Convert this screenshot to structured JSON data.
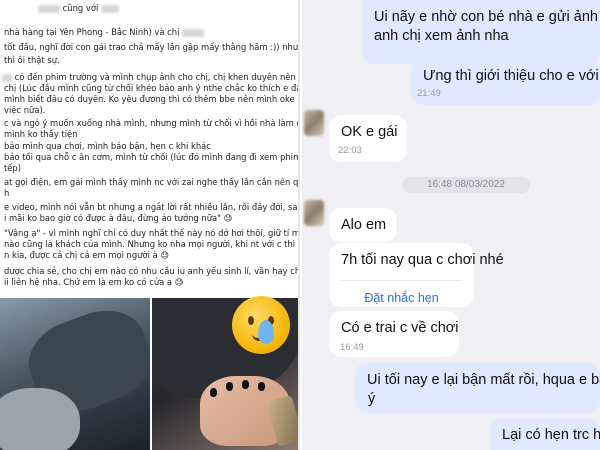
{
  "post": {
    "lines": [
      "cũng với",
      "nhà hàng tại Yên Phong - Bắc Ninh) và chị",
      "tốt đầu, nghĩ đời con gái trao chả mấy lần gặp mấy thằng hãm :)) nhưng đến",
      "thì ôi thật sự.",
      "có đến phim trường và mình chụp ảnh cho chị, chị khen duyên nên có ý",
      "chị (Lúc đầu mình cũng từ chối khéo bảo anh ý nthe chắc ko thích e đâu, chị",
      "mình biết đâu có duyên. Ko yêu đương thì có thêm bbe nên mình oke cho số, 1",
      "việc nữa).",
      "c và ngỏ ý muốn xuống nhà mình, nhưng mình từ chối vì hồi nhà làm cơm và",
      "mình ko thấy tiện",
      "bảo mình qua chơi, mình báo bận, hẹn c khi khác",
      "bảo tối qua chỗ c ăn cơm, mình từ chối (lúc đó mình đang đi xem phim với",
      "tếp)",
      "at gọi điện, em gái mình thấy mình nc với zai nghe thấy lần cần nên quay lại",
      "h",
      "e video, mình nói vẫn bt nhưng a ngắt lời rất nhiều lần, rồi đây đời, sau đó",
      "i mãi ko bao giờ có được à       đâu, đừng ảo tưởng nữa\" 😓",
      "\"Vâng ạ\" - vì mình nghĩ chỉ có duy nhất thế này nó dở hơi thôi, giữ tí mặt mũi",
      "nào cũng là khách của mình. Nhưng ko nha mọi người, khi nt với c         thì",
      "n kia, được cả chị cả em mọi người à 😓",
      "dược chia sẻ, cho chị em nào có nhu cầu iu anh       yếu sinh lí, văn hay chữ tốt",
      "ii liên hệ nha. Chứ em là em ko có cửa ạ 😓"
    ],
    "photo_emoji": "crying-face-emoji"
  },
  "chat": {
    "messages": [
      {
        "dir": "out",
        "lines": [
          "Ui nãy e nhờ con bé nhà e gửi ảnh hộ,",
          "anh chị xem ảnh nha"
        ]
      },
      {
        "dir": "out",
        "text": "Ưng thì giới thiệu cho e với nhe",
        "time": "21:49"
      },
      {
        "dir": "in",
        "text": "OK e gái",
        "time": "22:03"
      },
      {
        "dir": "in",
        "text": "Alo em"
      },
      {
        "dir": "in",
        "text": "7h tối nay qua c chơi nhé",
        "action": "Đặt nhắc hẹn"
      },
      {
        "dir": "in",
        "text": "Có e trai c về chơi",
        "time": "16:49"
      },
      {
        "dir": "out",
        "lines": [
          "Ui tối nay e lại bận mất rồi, hqua e bảo c",
          "ý"
        ]
      },
      {
        "dir": "out",
        "text": "Lại có hẹn trc hih"
      }
    ],
    "date_separator": "16:48 08/03/2022"
  },
  "colors": {
    "outgoing_bubble": "#dfe9ff",
    "incoming_bubble": "#ffffff",
    "chat_background": "#f0eff4",
    "link": "#2f6fdb"
  }
}
